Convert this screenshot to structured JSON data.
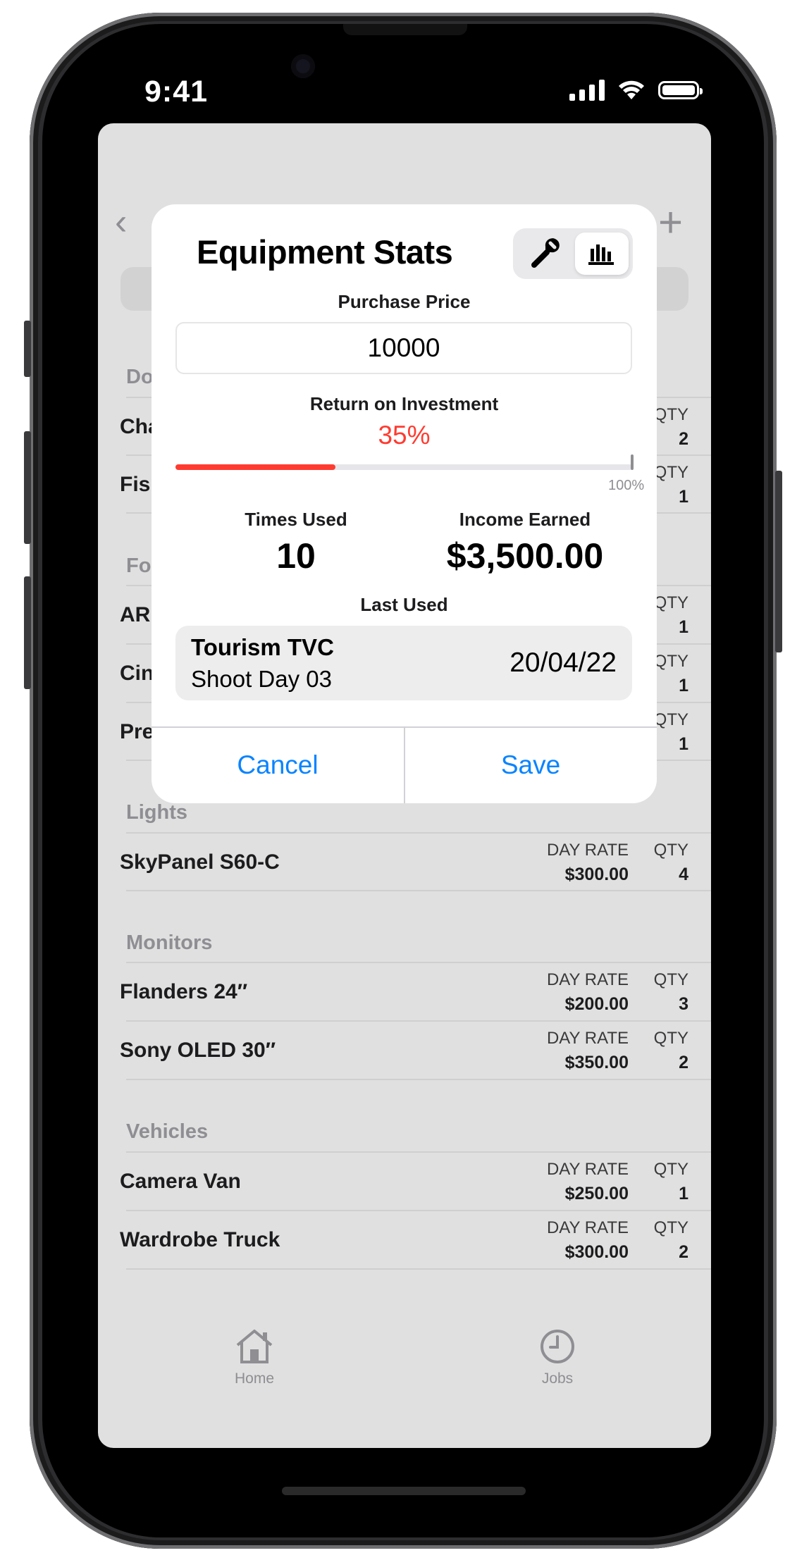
{
  "status_bar": {
    "time": "9:41"
  },
  "nav": {
    "back_glyph": "‹",
    "add_glyph": "+"
  },
  "list": {
    "partial_rows": [
      {
        "section": "Do",
        "items": [
          {
            "name": "Cha",
            "qty_label": "QTY",
            "qty": "2"
          },
          {
            "name": "Fis",
            "qty_label": "QTY",
            "qty": "1"
          }
        ]
      },
      {
        "section": "Fo",
        "items": [
          {
            "name": "AR",
            "qty_label": "QTY",
            "qty": "1"
          },
          {
            "name": "Cin",
            "qty_label": "QTY",
            "qty": "1"
          },
          {
            "name": "Pre",
            "qty_label": "QTY",
            "qty": "1"
          }
        ]
      }
    ],
    "sections": [
      {
        "title": "Lights",
        "items": [
          {
            "name": "SkyPanel S60-C",
            "rate_label": "DAY RATE",
            "rate": "$300.00",
            "qty_label": "QTY",
            "qty": "4"
          }
        ]
      },
      {
        "title": "Monitors",
        "items": [
          {
            "name": "Flanders 24″",
            "rate_label": "DAY RATE",
            "rate": "$200.00",
            "qty_label": "QTY",
            "qty": "3"
          },
          {
            "name": "Sony OLED 30″",
            "rate_label": "DAY RATE",
            "rate": "$350.00",
            "qty_label": "QTY",
            "qty": "2"
          }
        ]
      },
      {
        "title": "Vehicles",
        "items": [
          {
            "name": "Camera Van",
            "rate_label": "DAY RATE",
            "rate": "$250.00",
            "qty_label": "QTY",
            "qty": "1"
          },
          {
            "name": "Wardrobe Truck",
            "rate_label": "DAY RATE",
            "rate": "$300.00",
            "qty_label": "QTY",
            "qty": "2"
          }
        ]
      }
    ]
  },
  "tabbar": {
    "home_label": "Home",
    "jobs_label": "Jobs",
    "home_icon": "house-icon",
    "jobs_icon": "clock-icon"
  },
  "dialog": {
    "title": "Equipment Stats",
    "segments": [
      {
        "icon": "wrench-icon",
        "selected": false
      },
      {
        "icon": "bar-chart-icon",
        "selected": true
      }
    ],
    "purchase_price_label": "Purchase Price",
    "purchase_price_value": "10000",
    "roi_label": "Return on Investment",
    "roi_value": "35%",
    "roi_fraction": 0.35,
    "roi_max_label": "100%",
    "times_used_label": "Times Used",
    "times_used_value": "10",
    "income_label": "Income Earned",
    "income_value": "$3,500.00",
    "last_used_label": "Last Used",
    "last_used_job": "Tourism TVC",
    "last_used_detail": "Shoot Day 03",
    "last_used_date": "20/04/22",
    "cancel_label": "Cancel",
    "save_label": "Save"
  },
  "colors": {
    "accent": "#0a84ff",
    "roi": "#ff3b30",
    "dim_background": "#e0e0e0"
  }
}
